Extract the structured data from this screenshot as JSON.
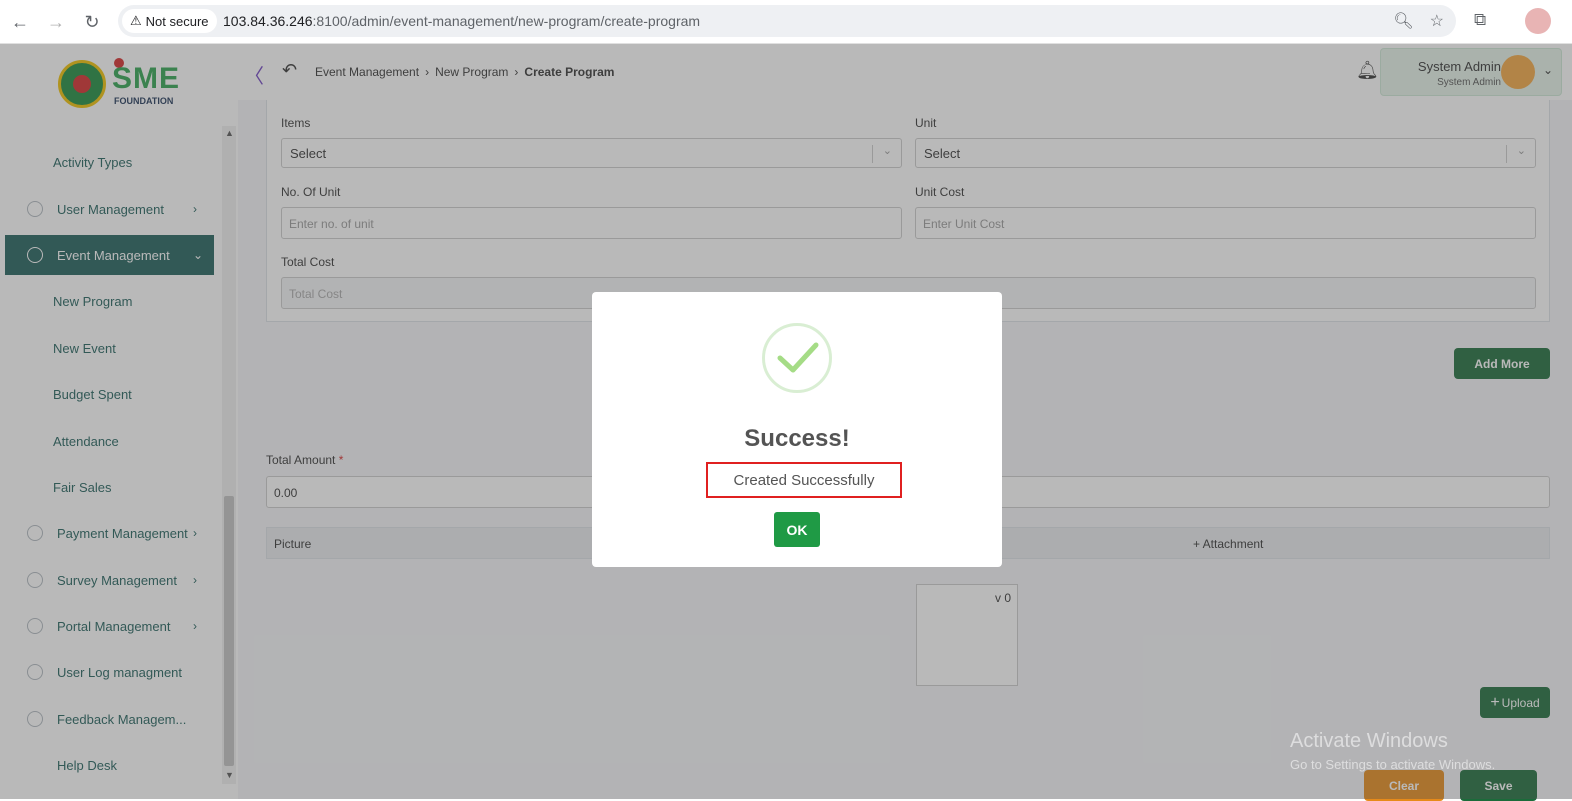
{
  "browser": {
    "not_secure_label": "Not secure",
    "url_host": "103.84.36.246",
    "url_rest": ":8100/admin/event-management/new-program/create-program"
  },
  "logo": {
    "brand": "SME",
    "tagline": "FOUNDATION"
  },
  "sidebar": {
    "items": [
      {
        "label": "Activity Types",
        "type": "sub"
      },
      {
        "label": "User Management",
        "type": "parent",
        "arrow": "›"
      },
      {
        "label": "Event Management",
        "type": "parent",
        "arrow": "⌄",
        "active": true
      },
      {
        "label": "New Program",
        "type": "sub"
      },
      {
        "label": "New Event",
        "type": "sub"
      },
      {
        "label": "Budget Spent",
        "type": "sub"
      },
      {
        "label": "Attendance",
        "type": "sub"
      },
      {
        "label": "Fair Sales",
        "type": "sub"
      },
      {
        "label": "Payment Management",
        "type": "parent",
        "arrow": "›"
      },
      {
        "label": "Survey Management",
        "type": "parent",
        "arrow": "›"
      },
      {
        "label": "Portal Management",
        "type": "parent",
        "arrow": "›"
      },
      {
        "label": "User Log managment",
        "type": "parent"
      },
      {
        "label": "Feedback Managem...",
        "type": "parent"
      },
      {
        "label": "Help Desk",
        "type": "parent"
      }
    ]
  },
  "header": {
    "breadcrumb": [
      "Event Management",
      "New Program",
      "Create Program"
    ],
    "user_name": "System Admin",
    "user_role": "System Admin"
  },
  "form": {
    "items_label": "Items",
    "items_value": "Select",
    "unit_label": "Unit",
    "unit_value": "Select",
    "no_of_unit_label": "No. Of Unit",
    "no_of_unit_placeholder": "Enter no. of unit",
    "unit_cost_label": "Unit Cost",
    "unit_cost_placeholder": "Enter Unit Cost",
    "total_cost_label": "Total Cost",
    "total_cost_placeholder": "Total Cost",
    "add_more_label": "Add More",
    "total_amount_label": "Total Amount",
    "total_amount_required": "*",
    "total_amount_value": "0.00",
    "table_col_picture": "Picture",
    "table_col_attachment": "+ Attachment",
    "preview_text": "v 0",
    "upload_label": "Upload",
    "cancel_label": "Clear",
    "save_label": "Save"
  },
  "watermark": {
    "line1": "Activate Windows",
    "line2": "Go to Settings to activate Windows."
  },
  "modal": {
    "title": "Success!",
    "message": "Created Successfully",
    "ok_label": "OK"
  },
  "colors": {
    "primary": "#1f5f5b",
    "button_green": "#1b6b3a",
    "ok_green": "#1f9a45",
    "highlight_red": "#e02020",
    "check_green": "#a5dc86"
  }
}
